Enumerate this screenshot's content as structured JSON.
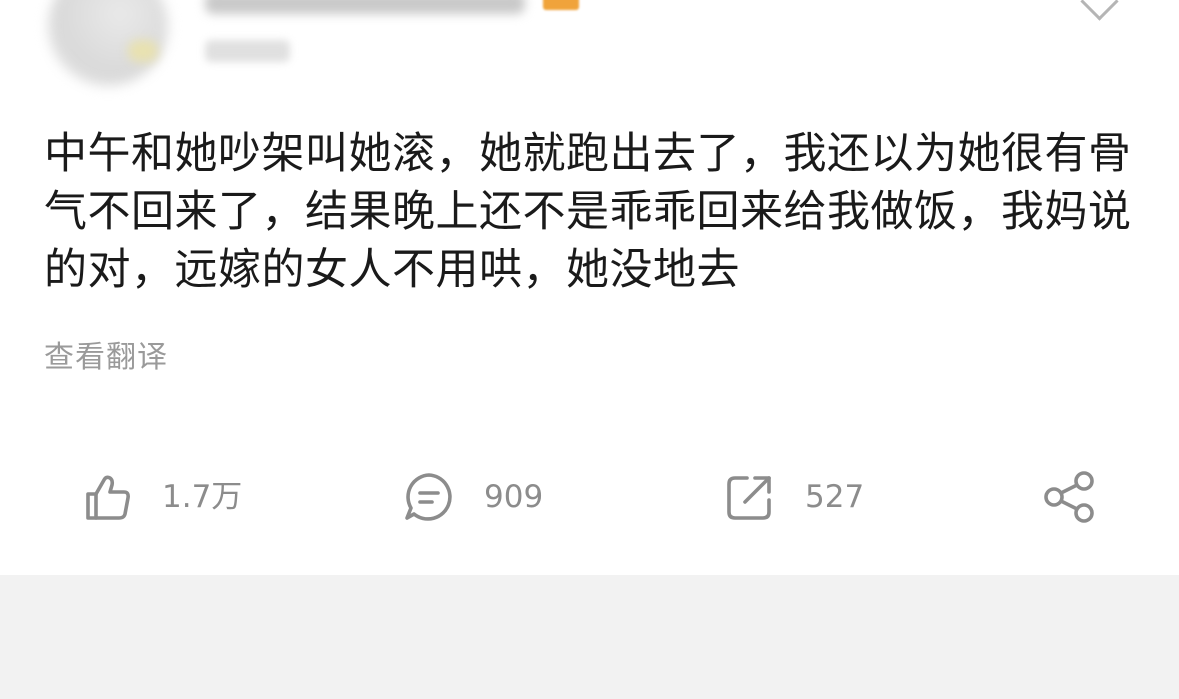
{
  "post": {
    "text": "中午和她吵架叫她滚，她就跑出去了，我还以为她很有骨气不回来了，结果晚上还不是乖乖回来给我做饭，我妈说的对，远嫁的女人不用哄，她没地去",
    "translate_label": "查看翻译"
  },
  "actions": {
    "like_count": "1.7万",
    "comment_count": "909",
    "repost_count": "527"
  },
  "icons": {
    "like": "thumbs-up-icon",
    "comment": "comment-bubble-icon",
    "repost": "repost-icon",
    "share": "share-icon",
    "more": "chevron-down-icon"
  },
  "colors": {
    "text": "#1a1a1a",
    "muted": "#8c8c8c",
    "vip": "#f0a33b",
    "separator_bg": "#f2f2f2"
  }
}
